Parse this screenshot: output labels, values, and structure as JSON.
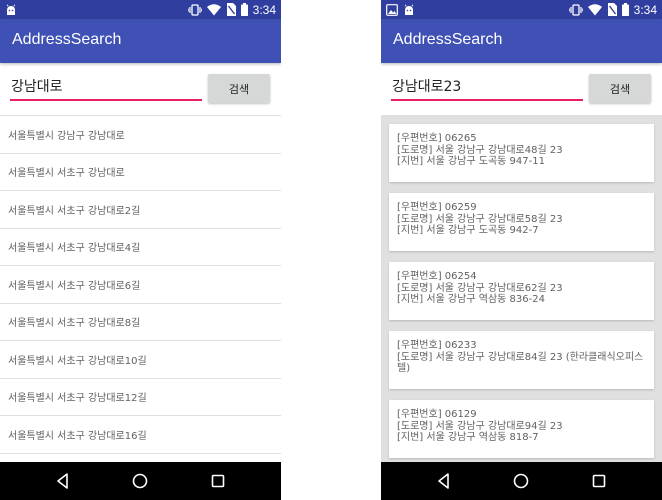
{
  "app": {
    "title": "AddressSearch"
  },
  "status_bar": {
    "time": "3:34"
  },
  "search": {
    "button_label": "검색"
  },
  "left": {
    "query": "강남대로",
    "suggestions": [
      "서울특별시 강남구 강남대로",
      "서울특별시 서초구 강남대로",
      "서울특별시 서초구 강남대로2길",
      "서울특별시 서초구 강남대로4길",
      "서울특별시 서초구 강남대로6길",
      "서울특별시 서초구 강남대로8길",
      "서울특별시 서초구 강남대로10길",
      "서울특별시 서초구 강남대로12길",
      "서울특별시 서초구 강남대로16길"
    ]
  },
  "right": {
    "query": "강남대로23",
    "results": [
      {
        "postal": "[우편번호] 06265",
        "road": "[도로명] 서울 강남구 강남대로48길 23",
        "lot": "[지번] 서울 강남구 도곡동 947-11"
      },
      {
        "postal": "[우편번호] 06259",
        "road": "[도로명] 서울 강남구 강남대로58길 23",
        "lot": "[지번] 서울 강남구 도곡동 942-7"
      },
      {
        "postal": "[우편번호] 06254",
        "road": "[도로명] 서울 강남구 강남대로62길 23",
        "lot": "[지번] 서울 강남구 역삼동 836-24"
      },
      {
        "postal": "[우편번호] 06233",
        "road": "[도로명] 서울 강남구 강남대로84길 23 (한라클래식오피스텔)",
        "lot": ""
      },
      {
        "postal": "[우편번호] 06129",
        "road": "[도로명] 서울 강남구 강남대로94길 23",
        "lot": "[지번] 서울 강남구 역삼동 818-7"
      }
    ]
  },
  "icons": {
    "status_left": [
      "android-icon",
      "image-icon"
    ],
    "status_right": [
      "vibrate-icon",
      "wifi-icon",
      "no-sim-icon",
      "battery-icon"
    ],
    "nav": [
      "back-icon",
      "home-icon",
      "recents-icon"
    ]
  },
  "colors": {
    "status_bar": "#303F9F",
    "app_bar": "#3F51B5",
    "accent": "#E91E63",
    "button": "#D6D7D7",
    "results_bg": "#E0E0E0"
  }
}
